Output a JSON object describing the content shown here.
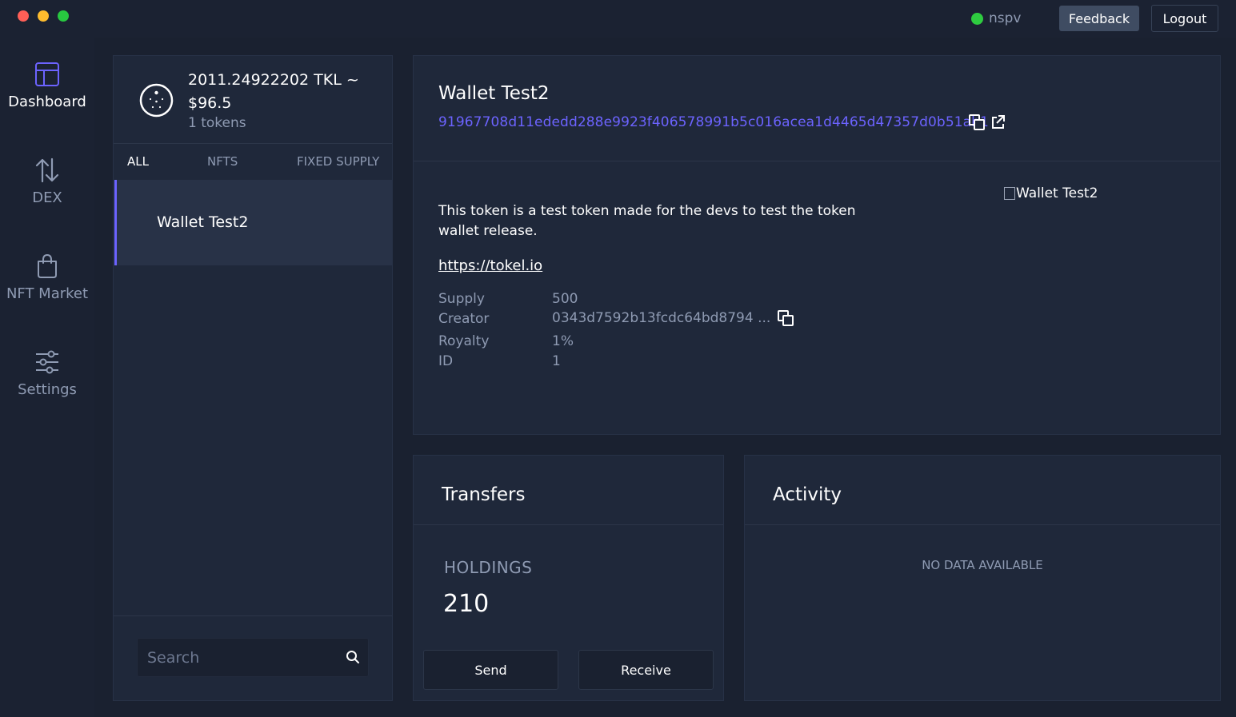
{
  "titlebar": {
    "network": "nspv",
    "feedback_label": "Feedback",
    "logout_label": "Logout",
    "colors": {
      "status_dot": "#2ecc40"
    }
  },
  "nav": {
    "items": [
      {
        "label": "Dashboard",
        "icon": "dashboard-icon",
        "active": true
      },
      {
        "label": "DEX",
        "icon": "swap-arrows-icon",
        "active": false
      },
      {
        "label": "NFT Market",
        "icon": "shopping-bag-icon",
        "active": false
      },
      {
        "label": "Settings",
        "icon": "sliders-icon",
        "active": false
      }
    ]
  },
  "token_list": {
    "balance_icon": "token-coin-icon",
    "balance": "2011.24922202 TKL ~ $96.5",
    "token_count": "1 tokens",
    "tabs": [
      {
        "label": "ALL",
        "active": true
      },
      {
        "label": "NFTS",
        "active": false
      },
      {
        "label": "FIXED SUPPLY",
        "active": false
      }
    ],
    "items": [
      {
        "name": "Wallet Test2",
        "selected": true
      }
    ],
    "search": {
      "placeholder": "Search",
      "value": ""
    }
  },
  "details": {
    "title": "Wallet Test2",
    "token_id_hash": "91967708d11ededd288e9923f406578991b5c016acea1d4465d47357d0b51ab1",
    "description": "This token is a test token made for the devs to test the token wallet release.",
    "url": "https://tokel.io",
    "image_alt": "Wallet Test2",
    "properties": [
      {
        "label": "Supply",
        "value": "500"
      },
      {
        "label": "Creator",
        "value": "0343d7592b13fcdc64bd8794 ..."
      },
      {
        "label": "Royalty",
        "value": "1%"
      },
      {
        "label": "ID",
        "value": "1"
      }
    ],
    "colors": {
      "accent": "#6c63ff"
    }
  },
  "transfers": {
    "title": "Transfers",
    "holdings_label": "HOLDINGS",
    "holdings_value": "210",
    "send_label": "Send",
    "receive_label": "Receive"
  },
  "activity": {
    "title": "Activity",
    "empty_text": "NO DATA AVAILABLE"
  }
}
